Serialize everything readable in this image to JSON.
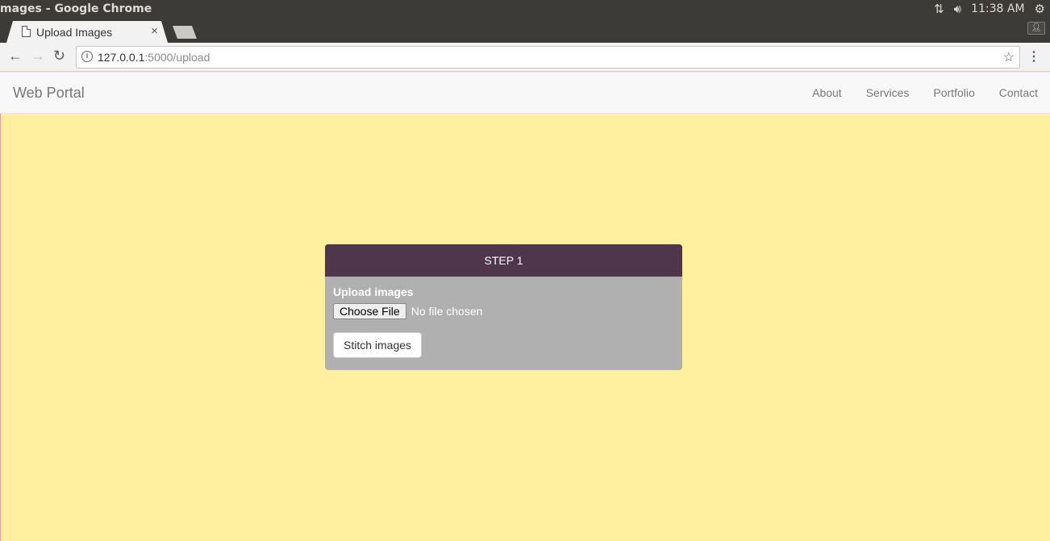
{
  "os": {
    "window_title": "mages - Google Chrome",
    "clock": "11:38 AM",
    "icons": [
      "network-icon",
      "volume-icon",
      "settings-gear-icon"
    ]
  },
  "browser": {
    "tab_title": "Upload Images",
    "tab_close": "×",
    "url_host": "127.0.0.1",
    "url_path": ":5000/upload"
  },
  "site": {
    "brand": "Web Portal",
    "nav": [
      {
        "label": "About"
      },
      {
        "label": "Services"
      },
      {
        "label": "Portfolio"
      },
      {
        "label": "Contact"
      }
    ]
  },
  "panel": {
    "heading": "STEP 1",
    "upload_label": "Upload images",
    "choose_file": "Choose File",
    "no_file": "No file chosen",
    "submit": "Stitch images"
  },
  "colors": {
    "background": "#fff0a0",
    "panel_heading": "#4f364c",
    "panel_body": "#b0b0b0"
  }
}
